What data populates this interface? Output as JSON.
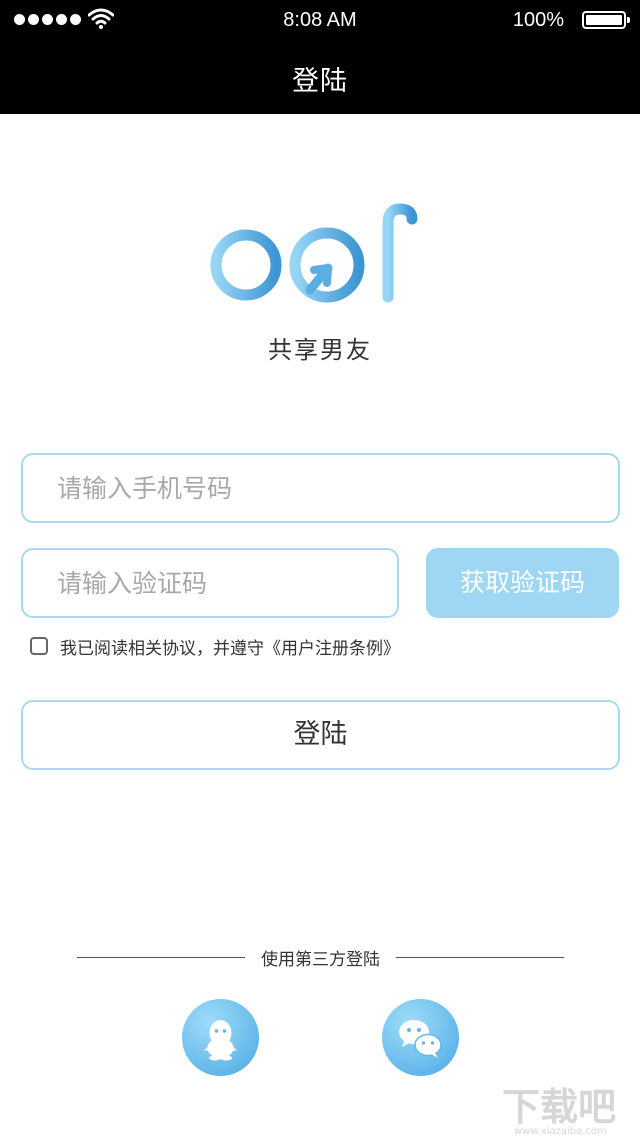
{
  "status_bar": {
    "time": "8:08 AM",
    "battery": "100%"
  },
  "nav": {
    "title": "登陆"
  },
  "brand": {
    "logo_text": "bof",
    "tagline": "共享男友"
  },
  "form": {
    "phone_placeholder": "请输入手机号码",
    "code_placeholder": "请输入验证码",
    "get_code_label": "获取验证码",
    "agreement_text": "我已阅读相关协议，并遵守《用户注册条例》",
    "agreement_checked": false,
    "login_label": "登陆"
  },
  "third_party": {
    "label": "使用第三方登陆",
    "providers": [
      "qq-icon",
      "wechat-icon"
    ]
  },
  "watermark": {
    "text": "下载吧",
    "url_text": "www.xiazaiba.com"
  },
  "colors": {
    "accent": "#9fd6f3",
    "border": "#a9d9f1",
    "logo_light": "#8fd0f2",
    "logo_dark": "#3d95d3"
  }
}
